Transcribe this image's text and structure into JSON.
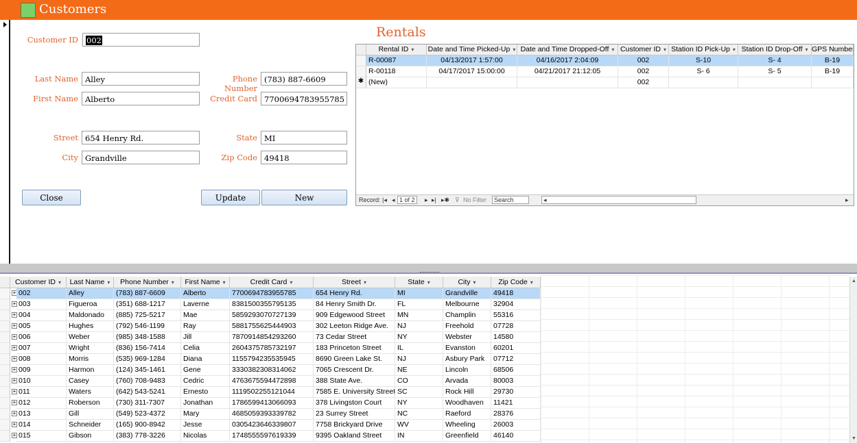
{
  "form": {
    "title": "Customers",
    "labels": {
      "customer_id": "Customer ID",
      "last_name": "Last Name",
      "first_name": "First Name",
      "phone_number": "Phone Number",
      "credit_card": "Credit Card",
      "street": "Street",
      "city": "City",
      "state": "State",
      "zip_code": "Zip Code"
    },
    "values": {
      "customer_id": "002",
      "last_name": "Alley",
      "first_name": "Alberto",
      "phone_number": "(783) 887-6609",
      "credit_card": "7700694783955785",
      "street": "654 Henry Rd.",
      "city": "Grandville",
      "state": "MI",
      "zip_code": "49418"
    },
    "buttons": {
      "close": "Close",
      "update": "Update",
      "new": "New"
    }
  },
  "rentals": {
    "title": "Rentals",
    "columns": [
      "Rental ID",
      "Date and Time Picked-Up",
      "Date and Time Dropped-Off",
      "Customer ID",
      "Station ID Pick-Up",
      "Station ID Drop-Off",
      "GPS Number"
    ],
    "rows": [
      [
        "R-00087",
        "04/13/2017 1:57:00",
        "04/16/2017 2:04:09",
        "002",
        "S-10",
        "S- 4",
        "B-19"
      ],
      [
        "R-00118",
        "04/17/2017 15:00:00",
        "04/21/2017 21:12:05",
        "002",
        "S- 6",
        "S- 5",
        "B-19"
      ]
    ],
    "new_row": [
      "(New)",
      "",
      "",
      "002",
      "",
      "",
      ""
    ],
    "nav": {
      "record_label": "Record:",
      "position": "1 of 2",
      "filter": "No Filter",
      "search": "Search"
    }
  },
  "customers_table": {
    "columns": [
      "Customer ID",
      "Last Name",
      "Phone Number",
      "First Name",
      "Credit Card",
      "Street",
      "State",
      "City",
      "Zip Code"
    ],
    "rows": [
      [
        "002",
        "Alley",
        "(783) 887-6609",
        "Alberto",
        "7700694783955785",
        "654 Henry Rd.",
        "MI",
        "Grandville",
        "49418"
      ],
      [
        "003",
        "Figueroa",
        "(351) 688-1217",
        "Laverne",
        "8381500355795135",
        "84 Henry Smith Dr.",
        "FL",
        "Melbourne",
        "32904"
      ],
      [
        "004",
        "Maldonado",
        "(885) 725-5217",
        "Mae",
        "5859293070727139",
        "909 Edgewood Street",
        "MN",
        "Champlin",
        "55316"
      ],
      [
        "005",
        "Hughes",
        "(792) 546-1199",
        "Ray",
        "5881755625444903",
        "302 Leeton Ridge Ave.",
        "NJ",
        "Freehold",
        "07728"
      ],
      [
        "006",
        "Weber",
        "(985) 348-1588",
        "Jill",
        "7870914854293260",
        "73 Cedar Street",
        "NY",
        "Webster",
        "14580"
      ],
      [
        "007",
        "Wright",
        "(836) 156-7414",
        "Celia",
        "2604375785732197",
        "183 Princeton Street",
        "IL",
        "Evanston",
        "60201"
      ],
      [
        "008",
        "Morris",
        "(535) 969-1284",
        "Diana",
        "1155794235535945",
        "8690 Green Lake St.",
        "NJ",
        "Asbury Park",
        "07712"
      ],
      [
        "009",
        "Harmon",
        "(124) 345-1461",
        "Gene",
        "3330382308314062",
        "7065 Crescent Dr.",
        "NE",
        "Lincoln",
        "68506"
      ],
      [
        "010",
        "Casey",
        "(760) 708-9483",
        "Cedric",
        "4763675594472898",
        "388 State Ave.",
        "CO",
        "Arvada",
        "80003"
      ],
      [
        "011",
        "Waters",
        "(642) 543-5241",
        "Ernesto",
        "1119502255121044",
        "7585 E. University Street",
        "SC",
        "Rock Hill",
        "29730"
      ],
      [
        "012",
        "Roberson",
        "(730) 311-7307",
        "Jonathan",
        "1786599413066093",
        "378 Livingston Court",
        "NY",
        "Woodhaven",
        "11421"
      ],
      [
        "013",
        "Gill",
        "(549) 523-4372",
        "Mary",
        "4685059393339782",
        "23 Surrey Street",
        "NC",
        "Raeford",
        "28376"
      ],
      [
        "014",
        "Schneider",
        "(165) 900-8942",
        "Jesse",
        "0305423646339807",
        "7758 Brickyard Drive",
        "WV",
        "Wheeling",
        "26003"
      ],
      [
        "015",
        "Gibson",
        "(383) 778-3226",
        "Nicolas",
        "1748555597619339",
        "9395 Oakland Street",
        "IN",
        "Greenfield",
        "46140"
      ]
    ]
  }
}
